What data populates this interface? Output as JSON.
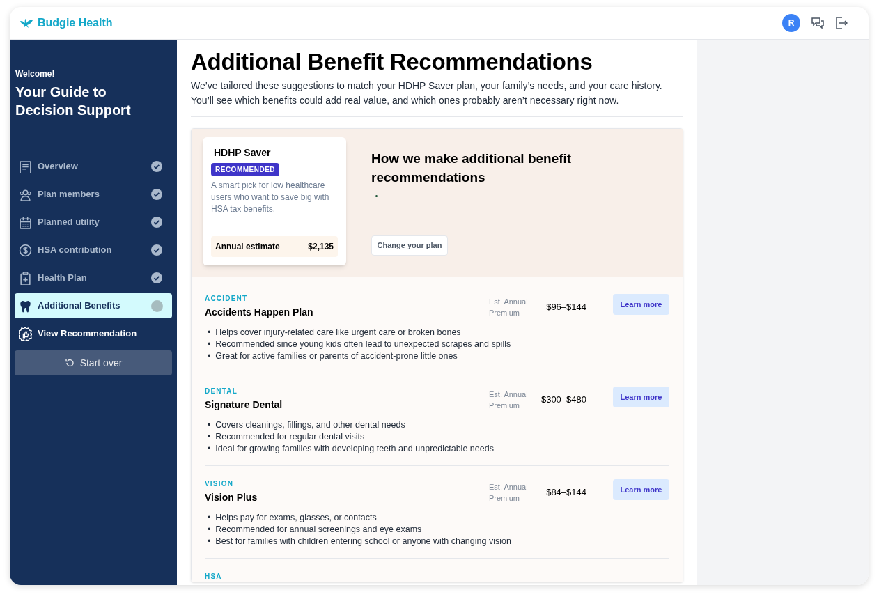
{
  "header": {
    "brand": "Budgie Health",
    "avatar": "R"
  },
  "sidebar": {
    "greeting": "Welcome!",
    "title": "Your Guide to Decision Support",
    "steps": [
      {
        "label": "Overview",
        "kind": "step",
        "completed": true,
        "selected": false
      },
      {
        "label": "Plan members",
        "kind": "step",
        "completed": true,
        "selected": false
      },
      {
        "label": "Planned utility",
        "kind": "step",
        "completed": true,
        "selected": false
      },
      {
        "label": "HSA contribution",
        "kind": "step",
        "completed": true,
        "selected": false
      },
      {
        "label": "Health Plan",
        "kind": "step",
        "completed": true,
        "selected": false
      },
      {
        "label": "Additional Benefits",
        "kind": "step",
        "completed": false,
        "selected": true
      },
      {
        "label": "View Recommendation",
        "kind": "final",
        "completed": false,
        "selected": false
      }
    ],
    "start_over": "Start over"
  },
  "page": {
    "title": "Additional Benefit Recommendations",
    "description": "We’ve tailored these suggestions to match your HDHP Saver plan, your family’s needs, and your care history. You’ll see which benefits could add real value, and which ones probably aren’t necessary right now."
  },
  "plan_card": {
    "name": "HDHP Saver",
    "badge": "RECOMMENDED",
    "description": "A smart pick for low healthcare users who want to save big with HSA tax benefits.",
    "estimate_label": "Annual estimate",
    "estimate_value": "$2,135"
  },
  "how": {
    "title": "How we make additional benefit recommendations",
    "change_button": "Change your plan"
  },
  "benefits": [
    {
      "category": "ACCIDENT",
      "name": "Accidents Happen Plan",
      "premium_label": "Est. Annual Premium",
      "price": "$96–$144",
      "button": "Learn more",
      "bullets": [
        "•  Helps cover injury-related care like urgent care or broken bones",
        "•  Recommended since young kids often lead to unexpected scrapes and spills",
        "•  Great for active families or parents of accident-prone little ones"
      ]
    },
    {
      "category": "DENTAL",
      "name": "Signature Dental",
      "premium_label": "Est. Annual Premium",
      "price": "$300–$480",
      "button": "Learn more",
      "bullets": [
        "•  Covers cleanings, fillings, and other dental needs",
        "•  Recommended for regular dental visits",
        "•  Ideal for growing families with developing teeth and unpredictable needs"
      ]
    },
    {
      "category": "VISION",
      "name": "Vision Plus",
      "premium_label": "Est. Annual Premium",
      "price": "$84–$144",
      "button": "Learn more",
      "bullets": [
        "•  Helps pay for exams, glasses, or contacts",
        "•  Recommended for annual screenings and eye exams",
        "•  Best for families with children entering school or anyone with changing vision"
      ]
    },
    {
      "category": "HSA"
    }
  ]
}
